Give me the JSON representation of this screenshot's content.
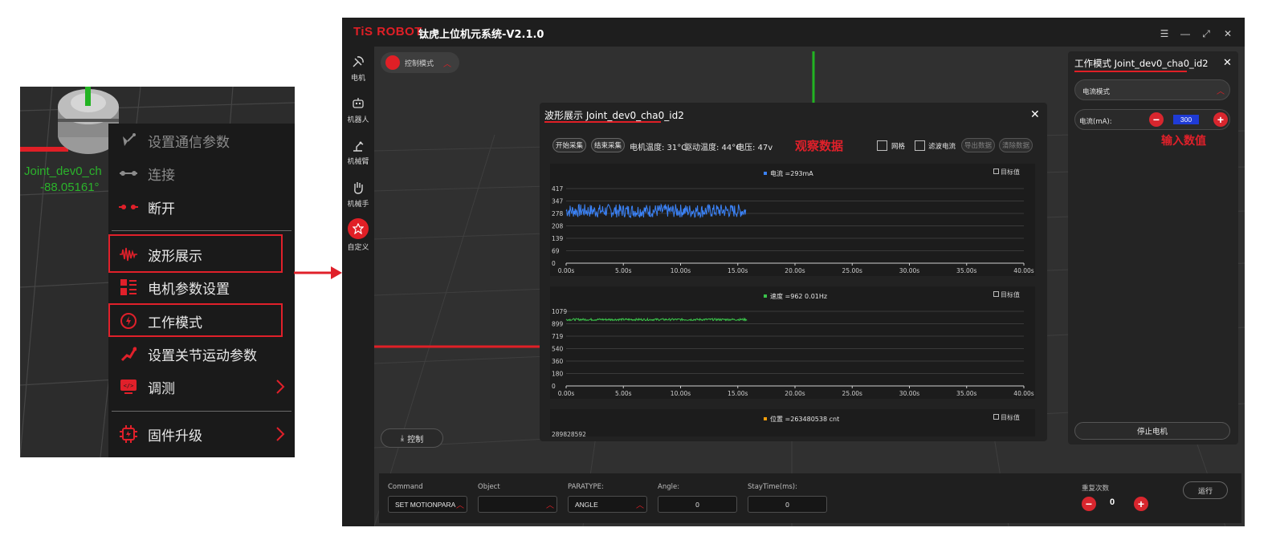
{
  "context_menu": {
    "joint_label": "Joint_dev0_ch",
    "joint_value": "-88.05161°",
    "items": [
      {
        "label": "设置通信参数",
        "icon": "satellite-icon",
        "dim": true
      },
      {
        "label": "连接",
        "icon": "connect-icon",
        "dim": true
      },
      {
        "label": "断开",
        "icon": "disconnect-icon",
        "dim": false
      },
      {
        "label": "波形展示",
        "icon": "waveform-icon",
        "dim": false,
        "highlighted": true
      },
      {
        "label": "电机参数设置",
        "icon": "settings-grid-icon",
        "dim": false
      },
      {
        "label": "工作模式",
        "icon": "power-mode-icon",
        "dim": false,
        "highlighted": true
      },
      {
        "label": "设置关节运动参数",
        "icon": "joint-motion-icon",
        "dim": false
      },
      {
        "label": "调测",
        "icon": "debug-icon",
        "dim": false,
        "submenu": true
      },
      {
        "label": "固件升级",
        "icon": "firmware-chip-icon",
        "dim": false,
        "submenu": true
      }
    ],
    "accent_color": "#e0202a"
  },
  "app": {
    "brand": "TiS ROBOT",
    "title": "钛虎上位机元系统-V2.1.0",
    "sidebar": [
      {
        "label": "电机",
        "icon": "motor-icon"
      },
      {
        "label": "机器人",
        "icon": "robot-icon"
      },
      {
        "label": "机械臂",
        "icon": "robot-arm-icon"
      },
      {
        "label": "机械手",
        "icon": "robot-hand-icon"
      },
      {
        "label": "自定义",
        "icon": "custom-icon",
        "active": true
      }
    ],
    "mode_chip": "控制模式",
    "control_button": "控制"
  },
  "wave_dialog": {
    "title": "波形展示 Joint_dev0_cha0_id2",
    "start_button": "开始采集",
    "stop_button": "结束采集",
    "motor_temp": "电机温度: 31°C",
    "driver_temp": "驱动温度: 44°C",
    "voltage": "电压: 47v",
    "annotation": "观察数据",
    "grid_label": "网格",
    "filter_label": "滤波电流",
    "export_button": "导出数据",
    "clear_button": "清除数据",
    "target_label": "目标值"
  },
  "chart_data": [
    {
      "type": "line",
      "series": [
        {
          "name": "电流 =293mA",
          "color": "#3b82f6"
        }
      ],
      "legend": "top-center",
      "y_ticks": [
        "417",
        "347",
        "278",
        "208",
        "139",
        "69",
        "0"
      ],
      "x_ticks": [
        "0.00s",
        "5.00s",
        "10.00s",
        "15.00s",
        "20.00s",
        "25.00s",
        "30.00s",
        "35.00s",
        "40.00s"
      ],
      "ylim": [
        0,
        417
      ],
      "xlim": [
        0,
        40
      ],
      "data_x_range": [
        0,
        15.7
      ],
      "approx_mean": 293,
      "approx_band": [
        255,
        330
      ],
      "noisy": true
    },
    {
      "type": "line",
      "series": [
        {
          "name": "速度 =962 0.01Hz",
          "color": "#3ac24a"
        }
      ],
      "legend": "top-center",
      "y_ticks": [
        "1079",
        "899",
        "719",
        "540",
        "360",
        "180",
        "0"
      ],
      "x_ticks": [
        "0.00s",
        "5.00s",
        "10.00s",
        "15.00s",
        "20.00s",
        "25.00s",
        "30.00s",
        "35.00s",
        "40.00s"
      ],
      "ylim": [
        0,
        1079
      ],
      "xlim": [
        0,
        40
      ],
      "data_x_range": [
        0,
        15.8
      ],
      "approx_mean": 962,
      "approx_band": [
        945,
        975
      ],
      "noisy": true
    },
    {
      "type": "line",
      "series": [
        {
          "name": "位置 =263480538 cnt",
          "color": "#f59e0b"
        }
      ],
      "legend": "top-center",
      "y_ticks": [
        "289828592"
      ]
    }
  ],
  "mode_panel": {
    "title": "工作模式 Joint_dev0_cha0_id2",
    "mode_select": "电流模式",
    "current_label": "电流(mA):",
    "current_value": "300",
    "annotation": "输入数值",
    "stop_motor": "停止电机"
  },
  "command_bar": {
    "command_label": "Command",
    "command_value": "SET MOTIONPARA",
    "object_label": "Object",
    "object_value": "",
    "paratype_label": "PARATYPE:",
    "paratype_value": "ANGLE",
    "angle_label": "Angle:",
    "angle_value": "0",
    "staytime_label": "StayTime(ms):",
    "staytime_value": "0",
    "repeat_label": "重复次数",
    "repeat_value": "0",
    "run_button": "运行"
  }
}
